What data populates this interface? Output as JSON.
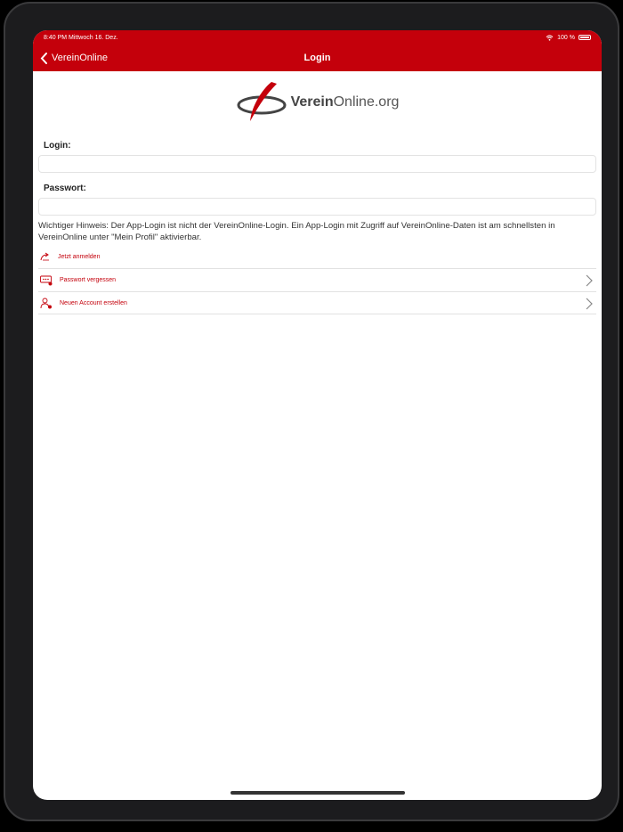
{
  "status": {
    "time_date": "8:40 PM  Mittwoch 16. Dez.",
    "battery": "100 %"
  },
  "nav": {
    "back_label": "VereinOnline",
    "title": "Login"
  },
  "logo": {
    "bold_part": "Verein",
    "light_part": "Online.org"
  },
  "form": {
    "login_label": "Login:",
    "login_value": "",
    "password_label": "Passwort:",
    "password_value": ""
  },
  "hint": "Wichtiger Hinweis: Der App-Login ist nicht der VereinOnline-Login. Ein App-Login mit Zugriff auf VereinOnline-Daten ist am schnellsten in VereinOnline unter \"Mein Profil\" aktivierbar.",
  "actions": {
    "login_now": "Jetzt anmelden",
    "forgot_password": "Passwort vergessen",
    "new_account": "Neuen Account erstellen"
  },
  "colors": {
    "brand_red": "#c4000b",
    "text": "#333333"
  }
}
